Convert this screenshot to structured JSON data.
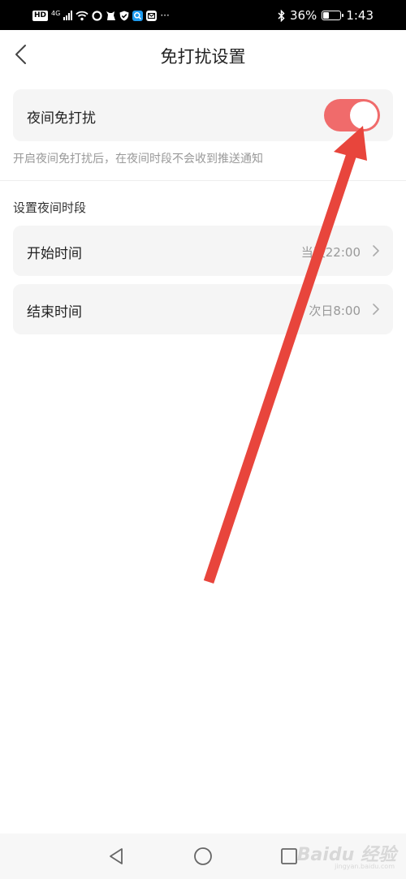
{
  "status_bar": {
    "hd": "HD",
    "network": "4G",
    "battery_percent_text": "36%",
    "battery_level": 0.36,
    "time": "1:43",
    "more": "···",
    "icons": [
      "hd-icon",
      "signal-icon",
      "wifi-icon",
      "circle-icon",
      "cat-icon",
      "shield-icon",
      "search-app-icon",
      "mail-icon",
      "more-icon",
      "bluetooth-icon",
      "battery-icon"
    ]
  },
  "header": {
    "title": "免打扰设置",
    "back_icon": "chevron-left-icon"
  },
  "night_dnd": {
    "label": "夜间免打扰",
    "enabled": true,
    "toggle_color": "#f06b6b",
    "hint": "开启夜间免打扰后，在夜间时段不会收到推送通知"
  },
  "schedule": {
    "section_title": "设置夜间时段",
    "rows": [
      {
        "label": "开始时间",
        "value": "当天22:00"
      },
      {
        "label": "结束时间",
        "value": "次日8:00"
      }
    ]
  },
  "annotation": {
    "arrow_color": "#e8453c"
  },
  "nav_bar": {
    "buttons": [
      "back-triangle-icon",
      "home-circle-icon",
      "recent-square-icon"
    ],
    "watermark": "Baidu 经验",
    "watermark_sub": "jingyan.baidu.com"
  }
}
